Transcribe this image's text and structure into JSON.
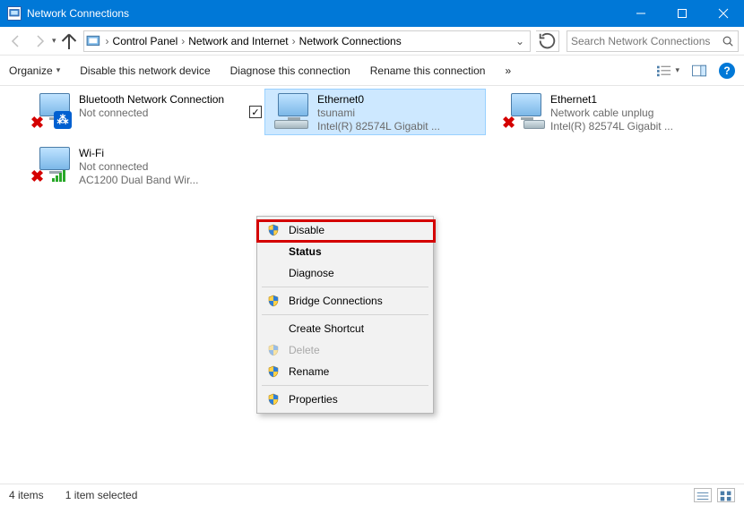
{
  "window": {
    "title": "Network Connections"
  },
  "breadcrumb": [
    "Control Panel",
    "Network and Internet",
    "Network Connections"
  ],
  "search": {
    "placeholder": "Search Network Connections"
  },
  "toolbar": {
    "organize": "Organize",
    "disable": "Disable this network device",
    "diagnose": "Diagnose this connection",
    "rename": "Rename this connection",
    "more": "»"
  },
  "adapters": [
    {
      "name": "Bluetooth Network Connection",
      "line2": "Not connected",
      "line3": ""
    },
    {
      "name": "Ethernet0",
      "line2": "tsunami",
      "line3": "Intel(R) 82574L Gigabit ..."
    },
    {
      "name": "Ethernet1",
      "line2": "Network cable unplug",
      "line3": "Intel(R) 82574L Gigabit ..."
    },
    {
      "name": "Wi-Fi",
      "line2": "Not connected",
      "line3": "AC1200  Dual Band Wir..."
    }
  ],
  "context_menu": {
    "disable": "Disable",
    "status": "Status",
    "diagnose": "Diagnose",
    "bridge": "Bridge Connections",
    "shortcut": "Create Shortcut",
    "delete": "Delete",
    "rename": "Rename",
    "properties": "Properties"
  },
  "status": {
    "count": "4 items",
    "selected": "1 item selected"
  }
}
